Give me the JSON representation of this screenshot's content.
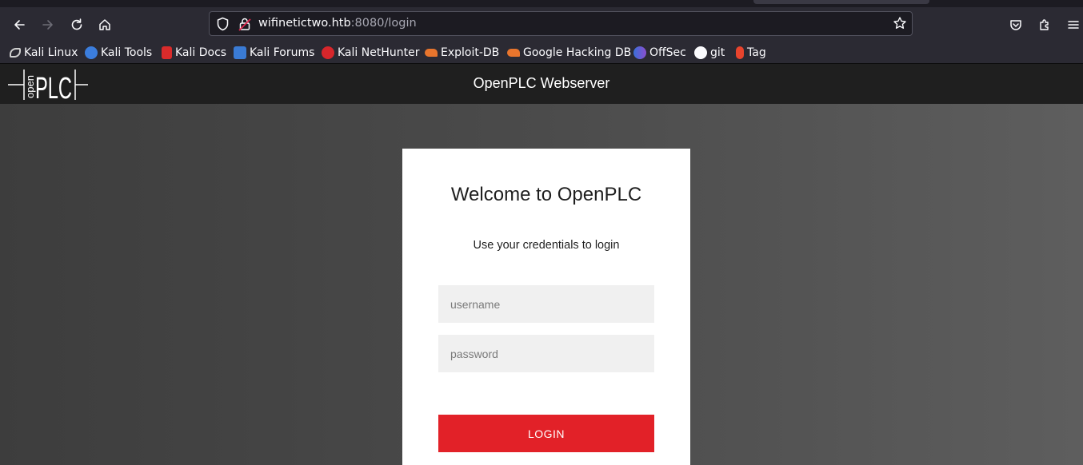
{
  "browser": {
    "url_host": "wifinetictwo.htb",
    "url_path": ":8080/login",
    "bookmarks": [
      {
        "label": "Kali Linux",
        "icon": "kali-dragon-icon",
        "color": "#cfcfcf"
      },
      {
        "label": "Kali Tools",
        "icon": "kali-tools-icon",
        "color": "#3b7ddd"
      },
      {
        "label": "Kali Docs",
        "icon": "kali-docs-icon",
        "color": "#d92b2b"
      },
      {
        "label": "Kali Forums",
        "icon": "kali-forums-icon",
        "color": "#3a7bd5"
      },
      {
        "label": "Kali NetHunter",
        "icon": "nethunter-icon",
        "color": "#d7262b"
      },
      {
        "label": "Exploit-DB",
        "icon": "exploitdb-icon",
        "color": "#e8752d"
      },
      {
        "label": "Google Hacking DB",
        "icon": "ghdb-icon",
        "color": "#e8752d"
      },
      {
        "label": "OffSec",
        "icon": "offsec-icon",
        "color": "#6a5acd"
      },
      {
        "label": "git",
        "icon": "github-icon",
        "color": "#ffffff"
      },
      {
        "label": "Tag",
        "icon": "tag-icon",
        "color": "#e8442d"
      }
    ]
  },
  "header": {
    "logo_text": "open PLC",
    "title": "OpenPLC Webserver"
  },
  "login": {
    "welcome": "Welcome to OpenPLC",
    "subtitle": "Use your credentials to login",
    "username_placeholder": "username",
    "password_placeholder": "password",
    "login_label": "LOGIN"
  },
  "colors": {
    "accent": "#e22128",
    "header_bg": "#1f1f1f"
  }
}
